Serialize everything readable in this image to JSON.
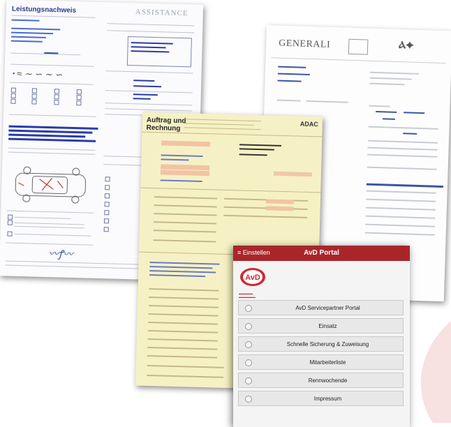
{
  "documents": {
    "leistung": {
      "title": "Leistungsnachweis",
      "brand": "ASSISTANCE"
    },
    "generali": {
      "brand": "GENERALI"
    },
    "adac": {
      "title_line1": "Auftrag und",
      "title_line2": "Rechnung",
      "brand": "ADAC"
    }
  },
  "portal": {
    "back_label": "Einstellen",
    "title": "AvD Portal",
    "logo_text": "AvD",
    "menu_items": [
      {
        "label": "AvD Servicepartner Portal"
      },
      {
        "label": "Einsatz"
      },
      {
        "label": "Schnelle Sicherung & Zuweisung"
      },
      {
        "label": "Mitarbeiterliste"
      },
      {
        "label": "Rennwochende"
      },
      {
        "label": "Impressum"
      }
    ]
  },
  "colors": {
    "portal_header": "#a8262a",
    "doc_blue": "#2a3ba8",
    "adac_paper": "#f6f1c4"
  }
}
